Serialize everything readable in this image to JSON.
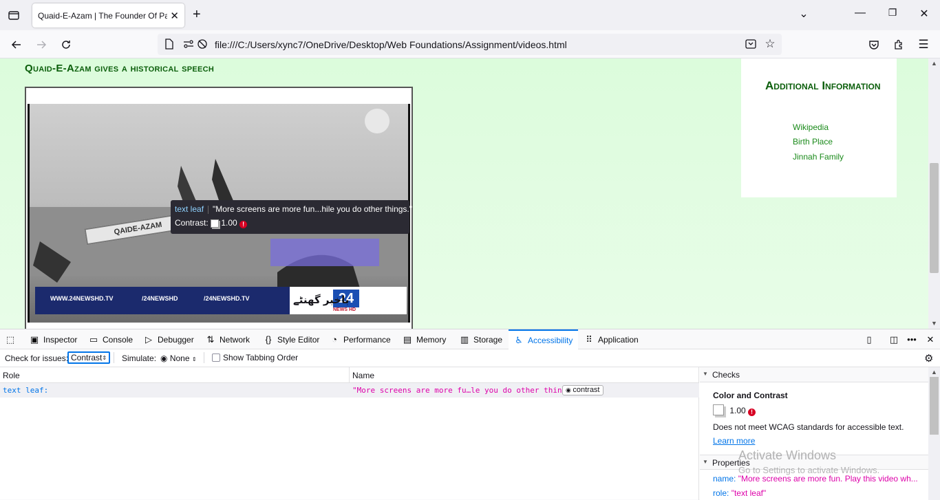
{
  "browser": {
    "tab_title": "Quaid-E-Azam | The Founder Of Pakistan",
    "url": "file:///C:/Users/xync7/OneDrive/Desktop/Web Foundations/Assignment/videos.html"
  },
  "page": {
    "heading": "Quaid-E-Azam gives a historical speech",
    "video": {
      "banner_text": "QAIDE-AZAM",
      "news_site": "WWW.24NEWSHD.TV",
      "news_twitter": "/24NEWSHD",
      "news_facebook": "/24NEWSHD.TV",
      "channel_logo": "24",
      "channel_sub": "NEWS HD",
      "urdu_tag": "باخبر گھنٹے"
    },
    "tooltip": {
      "role": "text leaf",
      "name": "\"More screens are more fun...hile you do other things.\"",
      "contrast_label": "Contrast:",
      "contrast_value": "1.00"
    },
    "sidebar": {
      "title": "Additional Information",
      "links": [
        "Wikipedia",
        "Birth Place",
        "Jinnah Family"
      ]
    }
  },
  "devtools": {
    "tabs": [
      "Inspector",
      "Console",
      "Debugger",
      "Network",
      "Style Editor",
      "Performance",
      "Memory",
      "Storage",
      "Accessibility",
      "Application"
    ],
    "active_tab": "Accessibility",
    "toolbar": {
      "check_label": "Check for issues:",
      "check_value": "Contrast",
      "simulate_label": "Simulate:",
      "simulate_value": "None",
      "tabbing_label": "Show Tabbing Order"
    },
    "tree": {
      "col_role": "Role",
      "col_name": "Name",
      "row_role": "text leaf:",
      "row_name": "\"More screens are more fu…le you do other things.\"",
      "row_badge": "contrast"
    },
    "checks": {
      "header": "Checks",
      "title": "Color and Contrast",
      "value": "1.00",
      "message": "Does not meet WCAG standards for accessible text.",
      "link": "Learn more"
    },
    "properties": {
      "header": "Properties",
      "name_key": "name:",
      "name_value": "\"More screens are more fun. Play this video wh...",
      "role_key": "role:",
      "role_value": "\"text leaf\""
    }
  },
  "watermark": {
    "line1": "Activate Windows",
    "line2": "Go to Settings to activate Windows."
  }
}
